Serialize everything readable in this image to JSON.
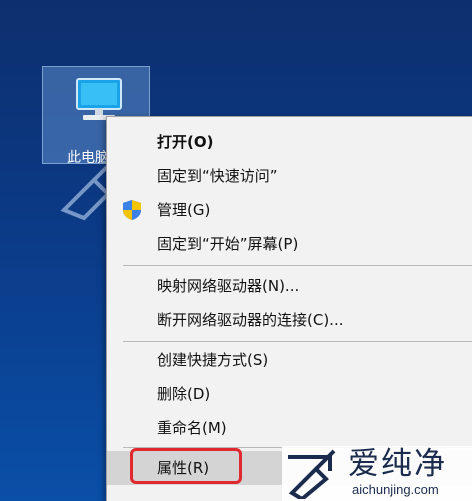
{
  "desktop": {
    "icon_label": "此电脑"
  },
  "context_menu": {
    "items": [
      {
        "label": "打开(O)"
      },
      {
        "label": "固定到“快速访问”"
      },
      {
        "label": "管理(G)",
        "icon": "uac-shield-icon"
      },
      {
        "label": "固定到“开始”屏幕(P)"
      },
      {
        "label": "映射网络驱动器(N)..."
      },
      {
        "label": "断开网络驱动器的连接(C)..."
      },
      {
        "label": "创建快捷方式(S)"
      },
      {
        "label": "删除(D)"
      },
      {
        "label": "重命名(M)"
      },
      {
        "label": "属性(R)"
      }
    ],
    "highlighted_item": "属性(R)"
  },
  "watermark": {
    "title": "爱纯净",
    "url": "aichunjing.com"
  },
  "colors": {
    "highlight_box": "#e0292e",
    "menu_background": "#f2f2f2",
    "desktop_background": "#0b3a86"
  }
}
